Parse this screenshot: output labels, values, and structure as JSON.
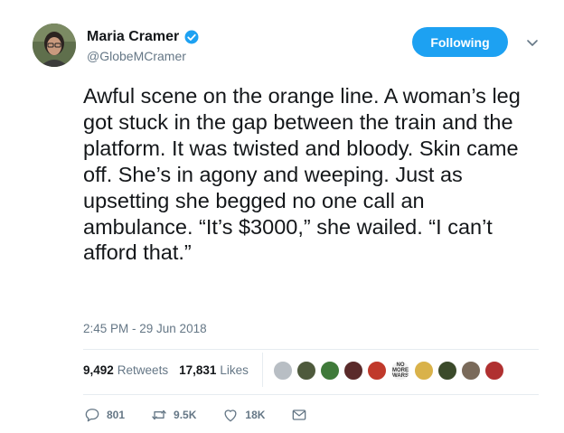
{
  "author": {
    "name": "Maria Cramer",
    "handle": "@GlobeMCramer",
    "verified": true
  },
  "follow_button": {
    "label": "Following"
  },
  "tweet": {
    "text": "Awful scene on the orange line. A woman’s leg got stuck in the gap between the train and the platform. It was twisted and bloody. Skin came off. She’s in agony and weeping. Just as upsetting she begged no one call an ambulance. “It’s $3000,” she wailed. “I can’t afford that.”",
    "timestamp": "2:45 PM - 29 Jun 2018"
  },
  "stats": {
    "retweets_count": "9,492",
    "retweets_label": "Retweets",
    "likes_count": "17,831",
    "likes_label": "Likes"
  },
  "liker_avatars": [
    {
      "color": "#b8bec4"
    },
    {
      "color": "#4e5a3c"
    },
    {
      "color": "#3f7a3a"
    },
    {
      "color": "#5a2a2a"
    },
    {
      "color": "#c0392b"
    },
    {
      "color": "#f2f2f2",
      "text": "NO MORE WARS"
    },
    {
      "color": "#d9b24a"
    },
    {
      "color": "#3b4a2a"
    },
    {
      "color": "#7a6a5a"
    },
    {
      "color": "#b03030"
    }
  ],
  "actions": {
    "reply_count": "801",
    "retweet_count": "9.5K",
    "like_count": "18K"
  },
  "colors": {
    "accent": "#1da1f2",
    "text": "#14171a",
    "secondary": "#657786",
    "divider": "#e6ecf0"
  }
}
